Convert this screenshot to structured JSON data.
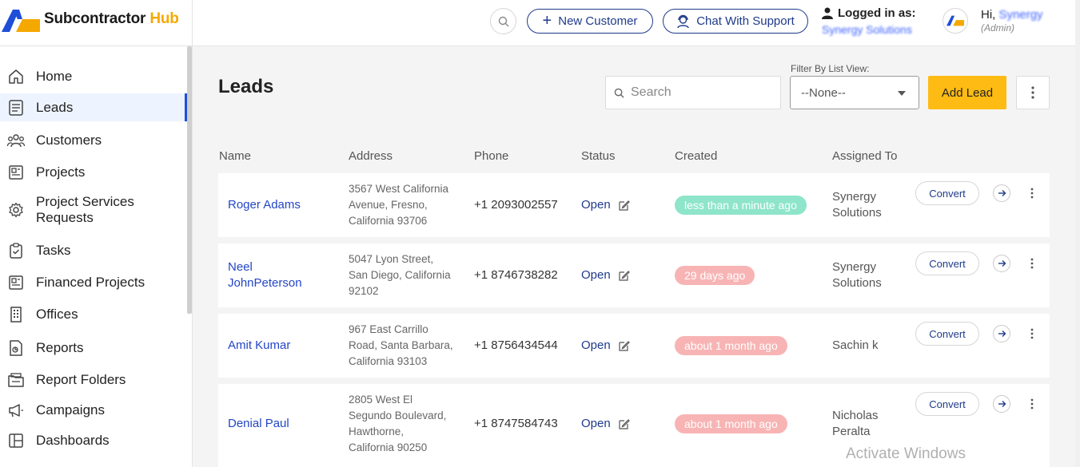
{
  "header": {
    "brand_main": "Subcontractor",
    "brand_accent": "Hub",
    "new_customer_label": "New Customer",
    "chat_support_label": "Chat With Support",
    "logged_in_label": "Logged in as:",
    "logged_in_org": "Synergy Solutions",
    "greeting": "Hi,",
    "user_name": "Synergy",
    "user_role": "(Admin)"
  },
  "sidebar": {
    "items": [
      {
        "label": "Home",
        "icon": "home-icon"
      },
      {
        "label": "Leads",
        "icon": "leads-icon",
        "active": true
      },
      {
        "label": "Customers",
        "icon": "customers-icon"
      },
      {
        "label": "Projects",
        "icon": "projects-icon"
      },
      {
        "label": "Project Services Requests",
        "icon": "gear-icon"
      },
      {
        "label": "Tasks",
        "icon": "clipboard-icon"
      },
      {
        "label": "Financed Projects",
        "icon": "financed-projects-icon"
      },
      {
        "label": "Offices",
        "icon": "building-icon"
      },
      {
        "label": "Reports",
        "icon": "report-icon"
      },
      {
        "label": "Report Folders",
        "icon": "folder-icon"
      },
      {
        "label": "Campaigns",
        "icon": "megaphone-icon"
      },
      {
        "label": "Dashboards",
        "icon": "dashboard-icon"
      }
    ]
  },
  "main": {
    "title": "Leads",
    "search_placeholder": "Search",
    "filter_label": "Filter By List View:",
    "filter_value": "--None--",
    "add_lead_label": "Add Lead",
    "columns": [
      "Name",
      "Address",
      "Phone",
      "Status",
      "Created",
      "Assigned To"
    ],
    "rows": [
      {
        "name": [
          "Roger Adams"
        ],
        "address": [
          "3567 West California",
          "Avenue, Fresno,",
          "California 93706"
        ],
        "phone": "+1 2093002557",
        "status": "Open",
        "created": "less than a minute ago",
        "created_color": "green",
        "assigned": [
          "Synergy",
          "Solutions"
        ],
        "convert_label": "Convert"
      },
      {
        "name": [
          "Neel",
          "JohnPeterson"
        ],
        "address": [
          "5047 Lyon Street,",
          "San Diego, California",
          "92102"
        ],
        "phone": "+1 8746738282",
        "status": "Open",
        "created": "29 days ago",
        "created_color": "pink",
        "assigned": [
          "Synergy",
          "Solutions"
        ],
        "convert_label": "Convert"
      },
      {
        "name": [
          "Amit Kumar"
        ],
        "address": [
          "967 East Carrillo",
          "Road, Santa Barbara,",
          "California 93103"
        ],
        "phone": "+1 8756434544",
        "status": "Open",
        "created": "about 1 month ago",
        "created_color": "pink",
        "assigned": [
          "Sachin k"
        ],
        "convert_label": "Convert"
      },
      {
        "name": [
          "Denial Paul"
        ],
        "address": [
          "2805 West El",
          "Segundo Boulevard,",
          "Hawthorne,",
          "California 90250"
        ],
        "phone": "+1 8747584743",
        "status": "Open",
        "created": "about 1 month ago",
        "created_color": "pink",
        "assigned": [
          "Nicholas",
          "Peralta"
        ],
        "convert_label": "Convert"
      }
    ]
  },
  "watermark": "Activate Windows",
  "colors": {
    "primary_blue": "#1f3a8a",
    "link_blue": "#2346c5",
    "accent_yellow": "#fdbb13",
    "badge_green": "#8ee5c9",
    "badge_pink": "#f8b4b4"
  }
}
